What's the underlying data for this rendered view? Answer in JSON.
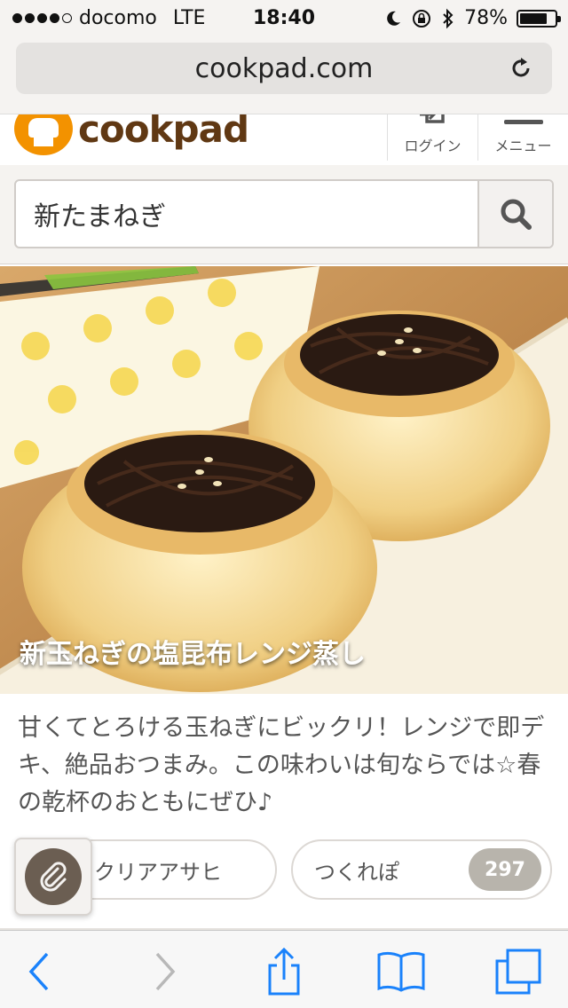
{
  "status_bar": {
    "carrier": "docomo",
    "network": "LTE",
    "time": "18:40",
    "battery": "78%",
    "battery_level": 0.78,
    "signal_bars": 4,
    "signal_total": 5
  },
  "browser": {
    "url": "cookpad.com"
  },
  "header": {
    "logo_text": "cookpad",
    "login_label": "ログイン",
    "menu_label": "メニュー"
  },
  "search": {
    "value": "新たまねぎ"
  },
  "hero": {
    "title": "新玉ねぎの塩昆布レンジ蒸し"
  },
  "description": "甘くてとろける玉ねぎにビックリ！レンジで即デキ、絶品おつまみ。この味わいは旬ならでは☆春の乾杯のおともにぜひ♪",
  "buttons": {
    "author_label": "クリアアサヒ",
    "tsukurepo_label": "つくれぽ",
    "tsukurepo_count": "297"
  },
  "colors": {
    "brand_orange": "#f39200",
    "brand_brown": "#603813",
    "ios_blue": "#1a82fb"
  },
  "icons": {
    "reload": "reload-icon",
    "login": "login-icon",
    "menu": "menu-icon",
    "search": "search-icon",
    "clip": "clip-icon",
    "back": "back-icon",
    "forward": "forward-icon",
    "share": "share-icon",
    "bookmarks": "bookmarks-icon",
    "tabs": "tabs-icon"
  }
}
